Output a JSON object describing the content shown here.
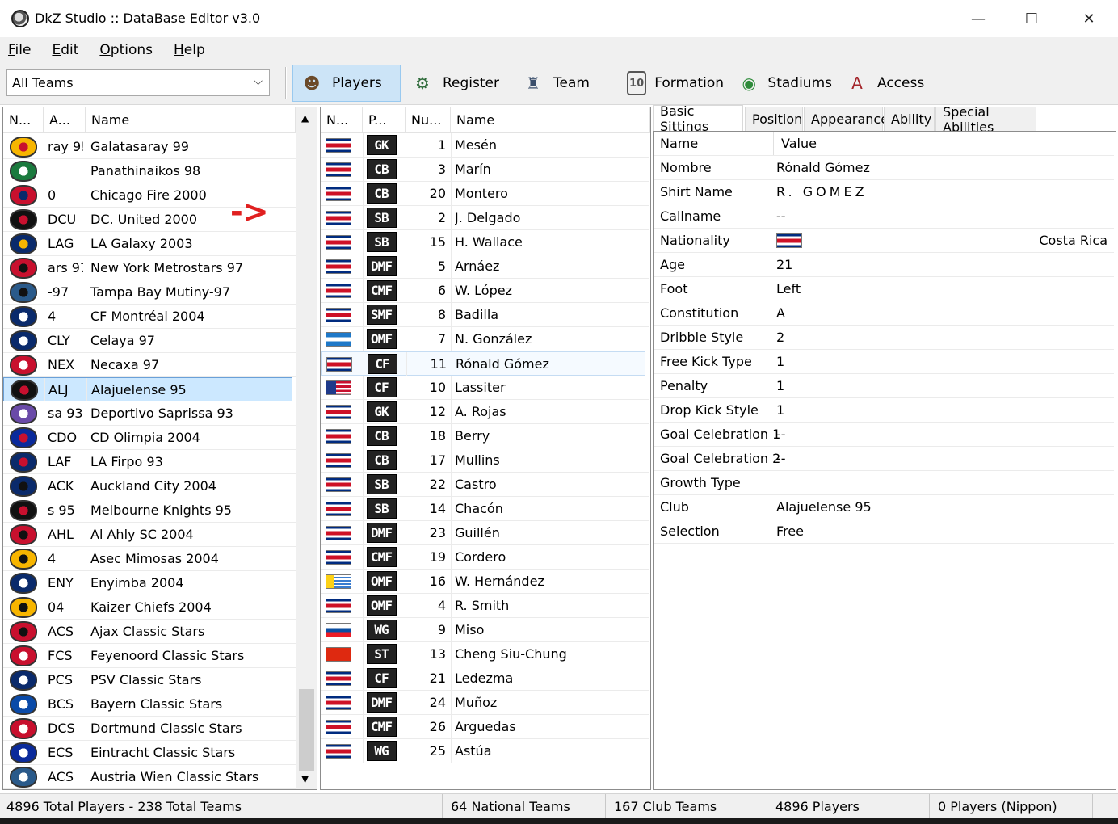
{
  "window": {
    "title": "DkZ Studio :: DataBase Editor v3.0",
    "minimize": "—",
    "maximize": "☐",
    "close": "✕"
  },
  "menu": [
    {
      "ul": "F",
      "rest": "ile"
    },
    {
      "ul": "E",
      "rest": "dit"
    },
    {
      "ul": "O",
      "rest": "ptions"
    },
    {
      "ul": "H",
      "rest": "elp"
    }
  ],
  "toolbar": {
    "filter": "All Teams",
    "buttons": [
      {
        "label": "Players",
        "icon": "player-icon",
        "glyph": "☻",
        "color": "#6b4a2a",
        "active": true
      },
      {
        "label": "Register",
        "icon": "register-icon",
        "glyph": "⚙",
        "color": "#2e6b3a",
        "active": false
      },
      {
        "label": "Team",
        "icon": "team-icon",
        "glyph": "♜",
        "color": "#3a4e6b",
        "active": false
      },
      {
        "label": "Formation",
        "icon": "formation-icon",
        "glyph": "10",
        "color": "#555",
        "active": false
      },
      {
        "label": "Stadiums",
        "icon": "stadium-icon",
        "glyph": "◉",
        "color": "#2e8b3a",
        "active": false
      },
      {
        "label": "Access",
        "icon": "access-icon",
        "glyph": "A",
        "color": "#a4262c",
        "active": false
      }
    ]
  },
  "teams": {
    "headers": [
      "N...",
      "A...",
      "Name"
    ],
    "selected_index": 10,
    "rows": [
      {
        "abbr": "ray 9!",
        "name": "Galatasaray 99",
        "c1": "#f7b500",
        "c2": "#c8102e"
      },
      {
        "abbr": "",
        "name": "Panathinaikos 98",
        "c1": "#1b7a3e",
        "c2": "#ffffff"
      },
      {
        "abbr": "0",
        "name": "Chicago Fire 2000",
        "c1": "#c8102e",
        "c2": "#0a2a6b"
      },
      {
        "abbr": "DCU",
        "name": "DC. United 2000",
        "c1": "#111111",
        "c2": "#c8102e"
      },
      {
        "abbr": "LAG",
        "name": "LA Galaxy 2003",
        "c1": "#0a2a6b",
        "c2": "#f7b500"
      },
      {
        "abbr": "ars 97",
        "name": "New York Metrostars 97",
        "c1": "#c8102e",
        "c2": "#111111"
      },
      {
        "abbr": "-97",
        "name": "Tampa Bay Mutiny-97",
        "c1": "#2a5a8a",
        "c2": "#111111"
      },
      {
        "abbr": "4",
        "name": "CF Montréal 2004",
        "c1": "#0a2a6b",
        "c2": "#ffffff"
      },
      {
        "abbr": "CLY",
        "name": "Celaya 97",
        "c1": "#0a2a6b",
        "c2": "#ffffff"
      },
      {
        "abbr": "NEX",
        "name": "Necaxa 97",
        "c1": "#c8102e",
        "c2": "#ffffff"
      },
      {
        "abbr": "ALJ",
        "name": "Alajuelense 95",
        "c1": "#111111",
        "c2": "#c8102e"
      },
      {
        "abbr": "sa 93",
        "name": "Deportivo Saprissa 93",
        "c1": "#6a4aa8",
        "c2": "#ffffff"
      },
      {
        "abbr": "CDO",
        "name": "CD Olimpia 2004",
        "c1": "#0a2a9b",
        "c2": "#c8102e"
      },
      {
        "abbr": "LAF",
        "name": "LA Firpo 93",
        "c1": "#0a2a6b",
        "c2": "#c8102e"
      },
      {
        "abbr": "ACK",
        "name": "Auckland City 2004",
        "c1": "#0a2a6b",
        "c2": "#111111"
      },
      {
        "abbr": "s 95",
        "name": "Melbourne Knights 95",
        "c1": "#111111",
        "c2": "#c8102e"
      },
      {
        "abbr": "AHL",
        "name": "Al Ahly SC 2004",
        "c1": "#c8102e",
        "c2": "#111111"
      },
      {
        "abbr": "4",
        "name": "Asec Mimosas 2004",
        "c1": "#f7b500",
        "c2": "#111111"
      },
      {
        "abbr": "ENY",
        "name": "Enyimba 2004",
        "c1": "#0a2a6b",
        "c2": "#ffffff"
      },
      {
        "abbr": "04",
        "name": "Kaizer Chiefs 2004",
        "c1": "#f7b500",
        "c2": "#111111"
      },
      {
        "abbr": "ACS",
        "name": "Ajax Classic Stars",
        "c1": "#c8102e",
        "c2": "#111111"
      },
      {
        "abbr": "FCS",
        "name": "Feyenoord Classic Stars",
        "c1": "#c8102e",
        "c2": "#ffffff"
      },
      {
        "abbr": "PCS",
        "name": "PSV Classic Stars",
        "c1": "#0a2a6b",
        "c2": "#ffffff"
      },
      {
        "abbr": "BCS",
        "name": "Bayern Classic Stars",
        "c1": "#0a4aa8",
        "c2": "#ffffff"
      },
      {
        "abbr": "DCS",
        "name": "Dortmund Classic Stars",
        "c1": "#c8102e",
        "c2": "#ffffff"
      },
      {
        "abbr": "ECS",
        "name": "Eintracht Classic Stars",
        "c1": "#0a2a9b",
        "c2": "#ffffff"
      },
      {
        "abbr": "ACS",
        "name": "Austria Wien Classic Stars",
        "c1": "#2a5a8a",
        "c2": "#ffffff"
      }
    ]
  },
  "players": {
    "headers": [
      "N...",
      "P...",
      "Nu...",
      "Name"
    ],
    "selected_index": 9,
    "rows": [
      {
        "flag": "cr",
        "pos": "GK",
        "num": "1",
        "name": "Mesén"
      },
      {
        "flag": "cr",
        "pos": "CB",
        "num": "3",
        "name": "Marín"
      },
      {
        "flag": "cr",
        "pos": "CB",
        "num": "20",
        "name": "Montero"
      },
      {
        "flag": "cr",
        "pos": "SB",
        "num": "2",
        "name": "J. Delgado"
      },
      {
        "flag": "cr",
        "pos": "SB",
        "num": "15",
        "name": "H. Wallace"
      },
      {
        "flag": "cr",
        "pos": "DMF",
        "num": "5",
        "name": "Arnáez"
      },
      {
        "flag": "cr",
        "pos": "CMF",
        "num": "6",
        "name": "W. López"
      },
      {
        "flag": "cr",
        "pos": "SMF",
        "num": "8",
        "name": "Badilla"
      },
      {
        "flag": "hn",
        "pos": "OMF",
        "num": "7",
        "name": "N. González"
      },
      {
        "flag": "cr",
        "pos": "CF",
        "num": "11",
        "name": "Rónald Gómez"
      },
      {
        "flag": "us",
        "pos": "CF",
        "num": "10",
        "name": "Lassiter"
      },
      {
        "flag": "cr",
        "pos": "GK",
        "num": "12",
        "name": "A. Rojas"
      },
      {
        "flag": "cr",
        "pos": "CB",
        "num": "18",
        "name": "Berry"
      },
      {
        "flag": "cr",
        "pos": "CB",
        "num": "17",
        "name": "Mullins"
      },
      {
        "flag": "cr",
        "pos": "SB",
        "num": "22",
        "name": "Castro"
      },
      {
        "flag": "cr",
        "pos": "SB",
        "num": "14",
        "name": "Chacón"
      },
      {
        "flag": "cr",
        "pos": "DMF",
        "num": "23",
        "name": "Guillén"
      },
      {
        "flag": "cr",
        "pos": "CMF",
        "num": "19",
        "name": "Cordero"
      },
      {
        "flag": "uy",
        "pos": "OMF",
        "num": "16",
        "name": "W. Hernández"
      },
      {
        "flag": "cr",
        "pos": "OMF",
        "num": "4",
        "name": "R. Smith"
      },
      {
        "flag": "sk",
        "pos": "WG",
        "num": "9",
        "name": "Miso"
      },
      {
        "flag": "hk",
        "pos": "ST",
        "num": "13",
        "name": "Cheng Siu-Chung"
      },
      {
        "flag": "cr",
        "pos": "CF",
        "num": "21",
        "name": "Ledezma"
      },
      {
        "flag": "cr",
        "pos": "DMF",
        "num": "24",
        "name": "Muñoz"
      },
      {
        "flag": "cr",
        "pos": "CMF",
        "num": "26",
        "name": "Arguedas"
      },
      {
        "flag": "cr",
        "pos": "WG",
        "num": "25",
        "name": "Astúa"
      }
    ]
  },
  "tabs": [
    "Basic Sittings",
    "Position",
    "Appearance",
    "Ability",
    "Special Abilities"
  ],
  "properties": {
    "headers": [
      "Name",
      "Value"
    ],
    "rows": [
      {
        "key": "Nombre",
        "value": "Rónald Gómez"
      },
      {
        "key": "Shirt Name",
        "value": "R. GOMEZ"
      },
      {
        "key": "Callname",
        "value": "--"
      },
      {
        "key": "Nationality",
        "value": "Costa Rica"
      },
      {
        "key": "Age",
        "value": "21"
      },
      {
        "key": "Foot",
        "value": "Left"
      },
      {
        "key": "Constitution",
        "value": "A"
      },
      {
        "key": "Dribble Style",
        "value": "2"
      },
      {
        "key": "Free Kick Type",
        "value": "1"
      },
      {
        "key": "Penalty",
        "value": "1"
      },
      {
        "key": "Drop Kick Style",
        "value": "1"
      },
      {
        "key": "Goal Celebration 1",
        "value": "--"
      },
      {
        "key": "Goal Celebration 2",
        "value": "--"
      },
      {
        "key": "Growth Type",
        "value": ""
      },
      {
        "key": "Club",
        "value": "Alajuelense 95"
      },
      {
        "key": "Selection",
        "value": "Free"
      }
    ]
  },
  "annotation": "->",
  "status": {
    "totals": "4896 Total Players  -  238 Total Teams",
    "national": "64 National Teams",
    "club": "167 Club Teams",
    "players": "4896 Players",
    "nippon": "0 Players (Nippon)"
  },
  "colors": {
    "accent": "#cce8ff",
    "accent_border": "#6aa0d8",
    "flag_red": "#ce1126",
    "flag_blue": "#002b7f"
  }
}
